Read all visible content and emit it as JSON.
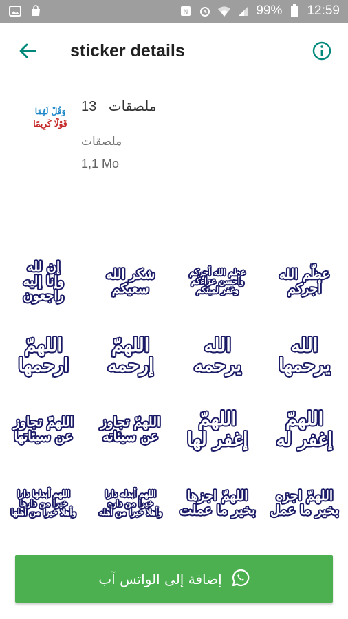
{
  "status_bar": {
    "battery_percent": "99%",
    "time": "12:59",
    "icons": [
      "gallery-icon",
      "shopping-bag-icon",
      "nfc-icon",
      "alarm-icon",
      "wifi-icon",
      "signal-icon",
      "battery-icon"
    ]
  },
  "toolbar": {
    "title": "sticker details",
    "back_icon": "arrow-left-icon",
    "info_icon": "info-icon",
    "accent": "#00897b"
  },
  "pack": {
    "logo_line1": "وَقُلْ لَهُمَا",
    "logo_line2": "قَوْلًا كَرِيمًا",
    "name": "ملصقات",
    "count": "13",
    "publisher": "ملصقات",
    "size": "1,1 Mo"
  },
  "stickers": [
    {
      "lines": [
        "إن لله",
        "وإنا إليه",
        "راجعون"
      ]
    },
    {
      "lines": [
        "شكر الله",
        "سعيكم"
      ]
    },
    {
      "lines": [
        "عظم الله أجركم",
        "وأحسن عزاءكم",
        "وغفر لميتكم"
      ]
    },
    {
      "lines": [
        "عظّم الله",
        "أجركم"
      ]
    },
    {
      "lines": [
        "اللهمّ",
        "ارحمها"
      ]
    },
    {
      "lines": [
        "اللهمّ",
        "إرحمه"
      ]
    },
    {
      "lines": [
        "الله",
        "يرحمه"
      ]
    },
    {
      "lines": [
        "الله",
        "يرحمها"
      ]
    },
    {
      "lines": [
        "اللهمّ تجاوز",
        "عن سيئاتها"
      ]
    },
    {
      "lines": [
        "اللهمّ تجاوز",
        "عن سيئاته"
      ]
    },
    {
      "lines": [
        "اللهمّ",
        "إغفر لها"
      ]
    },
    {
      "lines": [
        "اللهمّ",
        "إغفر له"
      ]
    },
    {
      "lines": [
        "اللهم أبدلها دارا",
        "خيرا من دارها",
        "وأهلا خيرا من أهلها"
      ]
    },
    {
      "lines": [
        "اللهم أبدله دارا",
        "خيرا من داره",
        "وأهلا خيرا من أهله"
      ]
    },
    {
      "lines": [
        "اللهمّ اجزها",
        "بخير ما عملت"
      ]
    },
    {
      "lines": [
        "اللهمّ اجزه",
        "بخير ما عمل"
      ]
    }
  ],
  "add_button": {
    "label": "إضافة إلى الواتس آب",
    "icon": "whatsapp-icon",
    "color": "#4caf50"
  }
}
